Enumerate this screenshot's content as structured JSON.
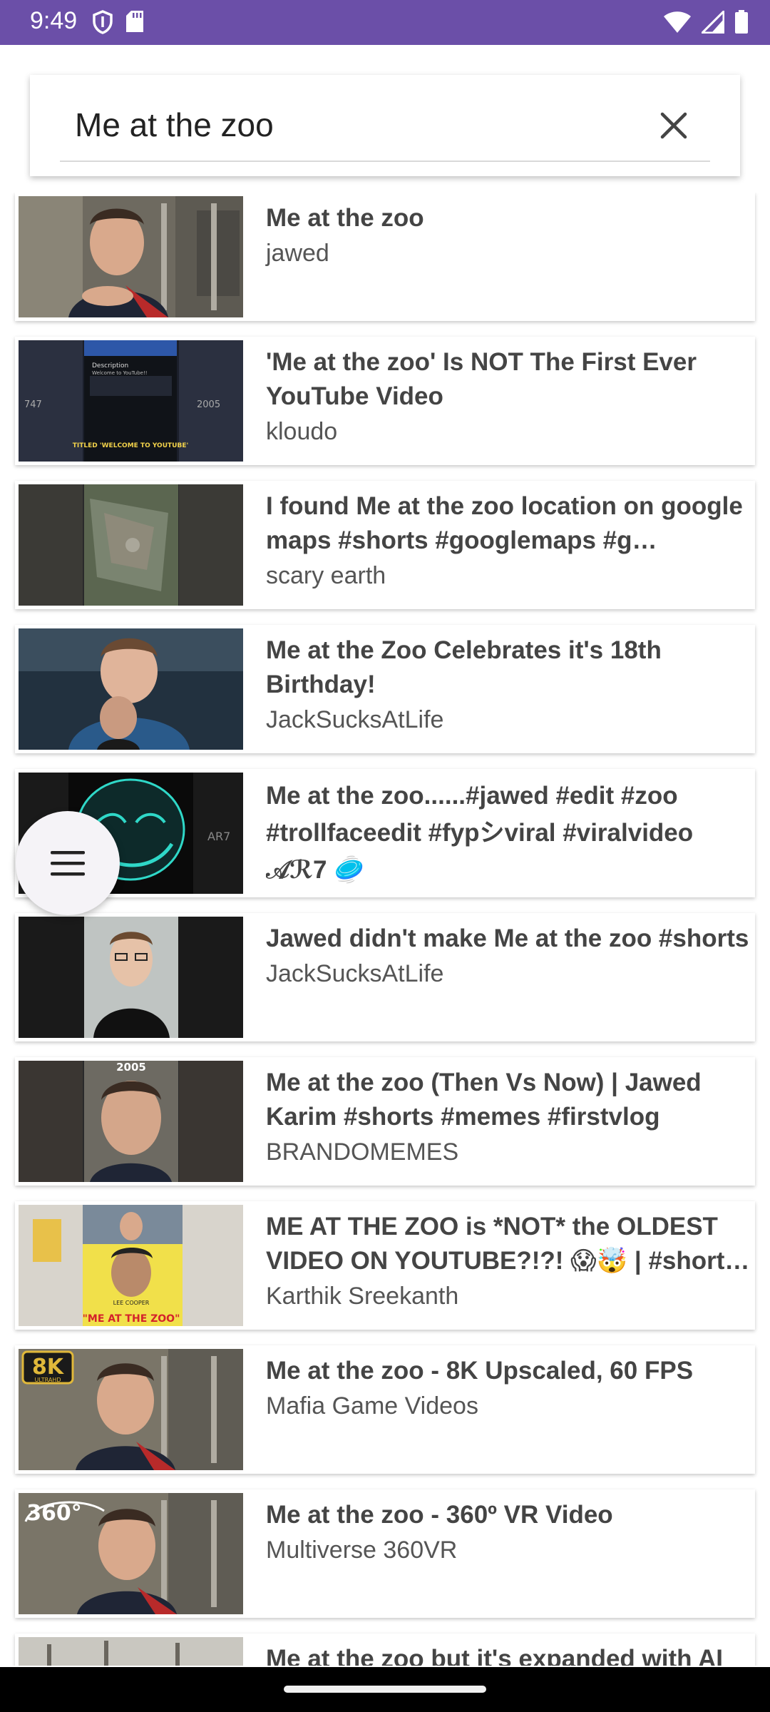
{
  "status_bar": {
    "time": "9:49",
    "left_icons": [
      "shield-icon",
      "sd-card-icon"
    ],
    "right_icons": [
      "wifi-icon",
      "cell-signal-icon",
      "battery-icon"
    ],
    "color": "#6b4fa8"
  },
  "search": {
    "query": "Me at the zoo",
    "clear_icon": "close-icon"
  },
  "fab": {
    "icon": "menu-icon"
  },
  "results": [
    {
      "title": "Me at the zoo",
      "channel": "jawed"
    },
    {
      "title": "'Me at the zoo' Is NOT The First Ever YouTube Video",
      "channel": "kloudo"
    },
    {
      "title": "I found Me at the zoo  location on google maps #shorts #googlemaps #g…",
      "channel": "scary earth"
    },
    {
      "title": "Me at the Zoo Celebrates it's 18th Birthday!",
      "channel": "JackSucksAtLife"
    },
    {
      "title": "Me at the zoo......#jawed #edit #zoo #trollfaceedit #fypシviral #viralvideo 𝒜ℛ7 🥏",
      "channel": ""
    },
    {
      "title": "Jawed didn't make Me at the zoo #shorts",
      "channel": "JackSucksAtLife"
    },
    {
      "title": "Me at the zoo (Then Vs Now) | Jawed Karim #shorts #memes #firstvlog",
      "channel": "BRANDOMEMES"
    },
    {
      "title": "ME AT THE ZOO is *NOT* the OLDEST VIDEO ON YOUTUBE?!?! 😱🤯 | #short…",
      "channel": "Karthik Sreekanth"
    },
    {
      "title": "Me at the zoo - 8K Upscaled, 60 FPS",
      "channel": "Mafia Game Videos"
    },
    {
      "title": "Me at the zoo - 360º VR Video",
      "channel": "Multiverse 360VR"
    },
    {
      "title": "Me at the zoo but it's expanded with AI",
      "channel": ""
    }
  ],
  "thumb_labels": {
    "kloudo_desc": "Description",
    "kloudo_welcome": "Welcome to YouTube!!",
    "kloudo_views": "747",
    "kloudo_year": "2005",
    "kloudo_caption": "TITLED 'WELCOME TO YOUTUBE'",
    "troll_tag": "AR7",
    "then_year": "2005",
    "badge_8k": "8K",
    "badge_8k_sub": "ULTRAHD",
    "badge_360": "360°",
    "zoo_caption": "\"ME AT THE ZOO\"",
    "lee_cooper": "LEE COOPER"
  }
}
